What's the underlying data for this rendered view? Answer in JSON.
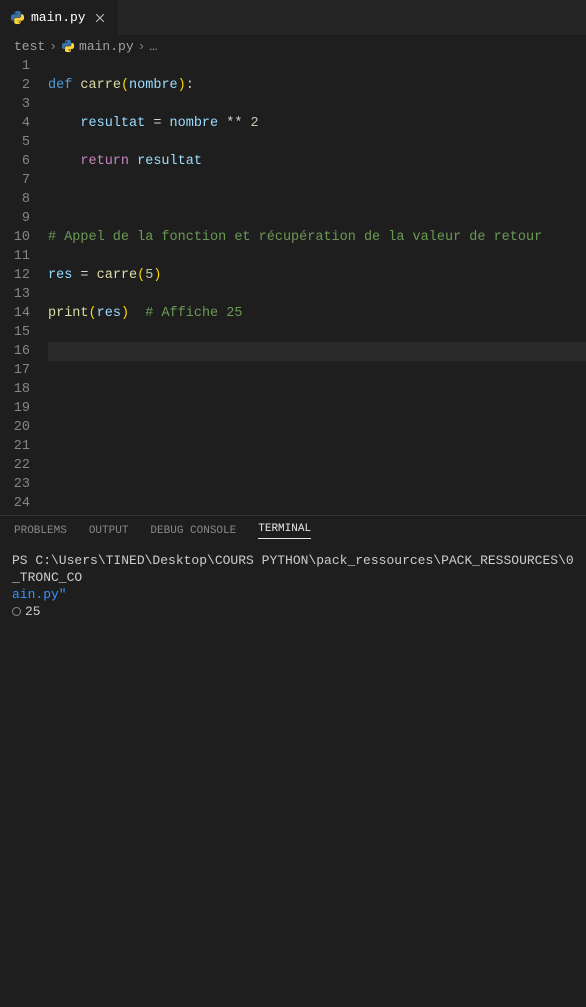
{
  "tab": {
    "filename": "main.py"
  },
  "breadcrumb": {
    "folder": "test",
    "file": "main.py",
    "more": "…"
  },
  "editor": {
    "lineCount": 24,
    "code": {
      "l1_def": "def",
      "l1_fn": "carre",
      "l1_p1": "(",
      "l1_arg": "nombre",
      "l1_p2": ")",
      "l1_colon": ":",
      "l2_var": "resultat",
      "l2_eq": " = ",
      "l2_rhs": "nombre",
      "l2_op": " ** ",
      "l2_num": "2",
      "l3_ret": "return",
      "l3_val": " resultat",
      "l5_cmt": "# Appel de la fonction et récupération de la valeur de retour",
      "l6_var": "res",
      "l6_eq": " = ",
      "l6_fn": "carre",
      "l6_p1": "(",
      "l6_num": "5",
      "l6_p2": ")",
      "l7_fn": "print",
      "l7_p1": "(",
      "l7_arg": "res",
      "l7_p2": ")",
      "l7_cmt": "  # Affiche 25"
    }
  },
  "panel": {
    "tabs": {
      "problems": "PROBLEMS",
      "output": "OUTPUT",
      "debug": "DEBUG CONSOLE",
      "terminal": "TERMINAL"
    },
    "terminal": {
      "line1a": "PS C:\\Users\\TINED\\Desktop\\COURS PYTHON\\pack_ressources\\PACK_RESSOURCES\\0_TRONC_CO",
      "line1b": "ain.py\"",
      "line2": "25"
    }
  }
}
